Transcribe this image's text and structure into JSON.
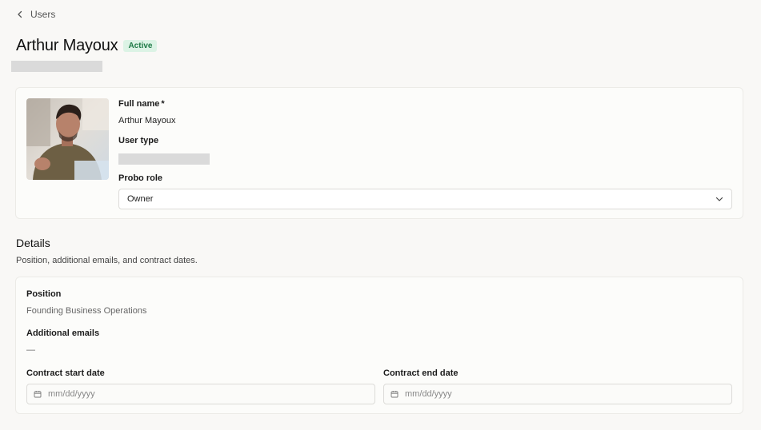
{
  "nav": {
    "back_label": "Users",
    "back_icon": "chevron-left-icon"
  },
  "header": {
    "title": "Arthur Mayoux",
    "status": "Active",
    "status_color": "#1e7a46",
    "status_bg": "#dcf3e5"
  },
  "profile": {
    "full_name_label": "Full name",
    "required_mark": "*",
    "full_name_value": "Arthur Mayoux",
    "user_type_label": "User type",
    "role_label": "Probo role",
    "role_value": "Owner",
    "role_icon": "chevron-down-icon"
  },
  "details": {
    "title": "Details",
    "description": "Position, additional emails, and contract dates.",
    "position_label": "Position",
    "position_value": "Founding Business Operations",
    "emails_label": "Additional emails",
    "emails_value": "—",
    "contract_start_label": "Contract start date",
    "contract_start_placeholder": "mm/dd/yyyy",
    "contract_end_label": "Contract end date",
    "contract_end_placeholder": "mm/dd/yyyy",
    "date_icon": "calendar-icon"
  }
}
